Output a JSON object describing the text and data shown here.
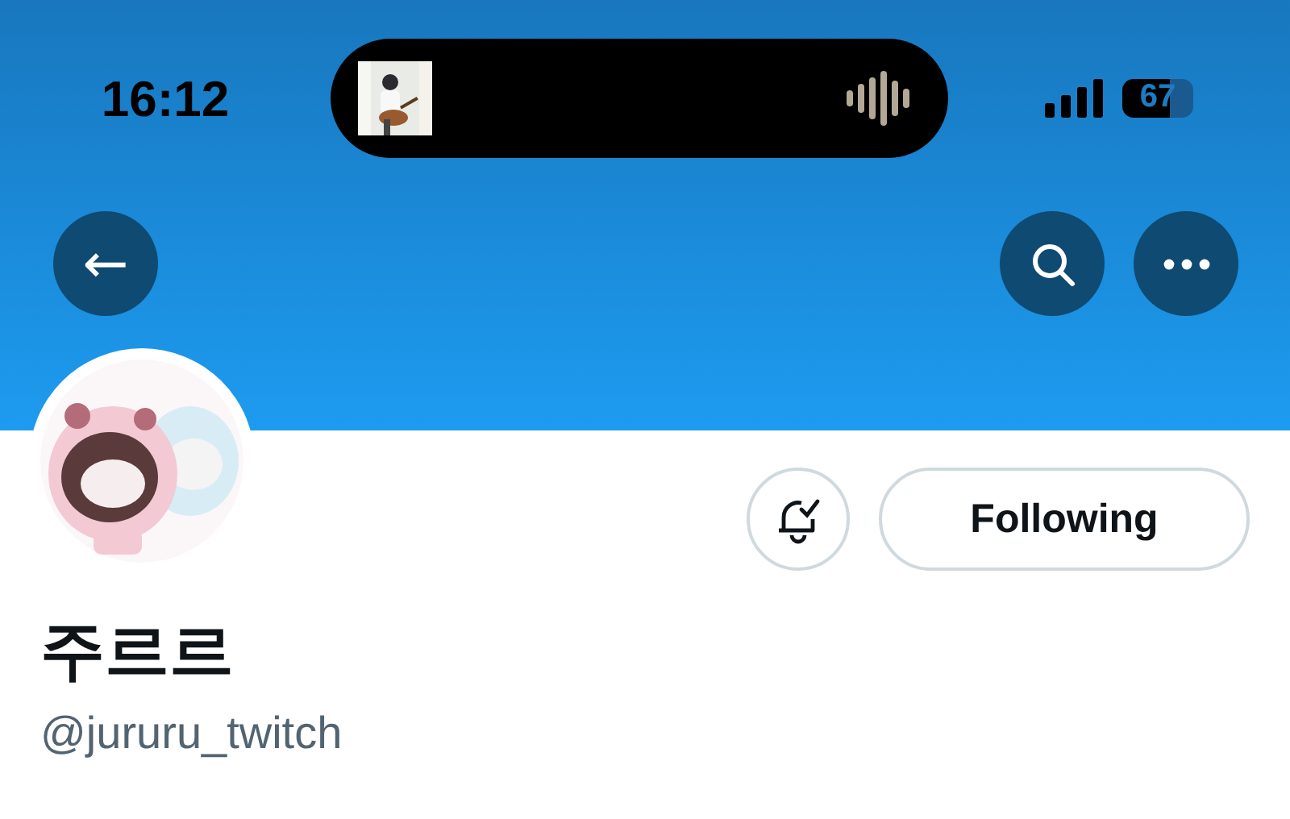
{
  "status_bar": {
    "time": "16:12",
    "battery": "67"
  },
  "header": {
    "back": "←"
  },
  "profile": {
    "name": "주르르",
    "handle": "@jururu_twitch",
    "notifications_on": true,
    "follow_button": "Following"
  }
}
